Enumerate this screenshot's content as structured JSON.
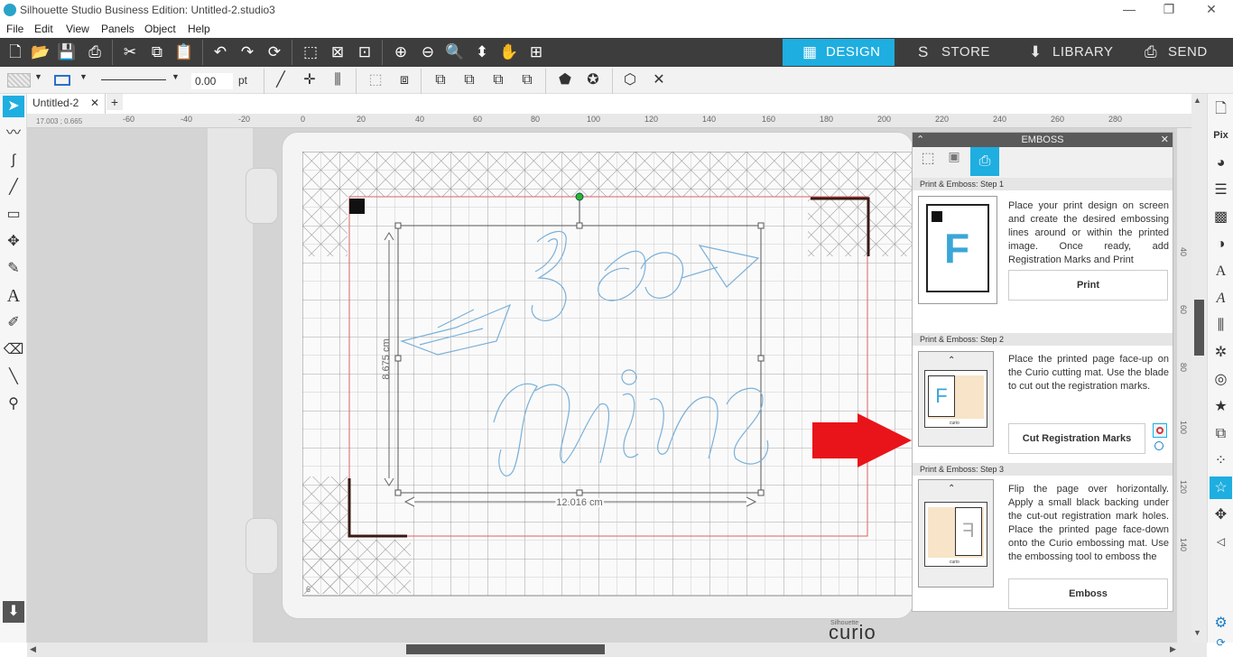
{
  "window": {
    "title": "Silhouette Studio Business Edition: Untitled-2.studio3"
  },
  "menu": [
    "File",
    "Edit",
    "View",
    "Panels",
    "Object",
    "Help"
  ],
  "nav": {
    "design": "DESIGN",
    "store": "STORE",
    "library": "LIBRARY",
    "send": "SEND"
  },
  "toolbar2": {
    "line_weight": "0.00",
    "unit": "pt"
  },
  "document": {
    "tab": "Untitled-2",
    "coords": "17.003 ; 0.665"
  },
  "ruler_top": [
    "-60",
    "-40",
    "-20",
    "0",
    "20",
    "40",
    "60",
    "80",
    "100",
    "120",
    "140",
    "160",
    "180",
    "200",
    "220",
    "240",
    "260",
    "280"
  ],
  "ruler_right": [
    "20",
    "40",
    "60",
    "80",
    "100",
    "120",
    "140"
  ],
  "canvas": {
    "dim_h": "8.675 cm",
    "dim_w": "12.016 cm",
    "page_num": "6",
    "design_text": "Be mine",
    "brand": "curio",
    "brand_sub": "Silhouette"
  },
  "emboss": {
    "title": "EMBOSS",
    "steps": [
      {
        "header": "Print & Emboss: Step 1",
        "text": "Place your print design on screen and create the desired embossing lines around or within the printed image. Once ready, add Registration Marks and Print",
        "button": "Print",
        "thumb_letter": "F"
      },
      {
        "header": "Print & Emboss: Step 2",
        "text": "Place the printed page face-up on the Curio cutting mat. Use the blade to cut out the registration marks.",
        "button": "Cut Registration Marks",
        "thumb_letter": "F",
        "thumb_label": "curio"
      },
      {
        "header": "Print & Emboss: Step 3",
        "text": "Flip the page over horizontally. Apply a small black backing under the cut-out registration mark holes. Place the printed page face-down onto the Curio embossing mat. Use the embossing tool to emboss the",
        "button": "Emboss",
        "thumb_letter": "F",
        "thumb_label": "curio"
      }
    ]
  },
  "colors": {
    "accent": "#1eaee0",
    "toolbar": "#3d3d3d",
    "arrow": "#e8141a",
    "design_stroke": "#7ab0d8",
    "cut_line": "#e06060"
  }
}
